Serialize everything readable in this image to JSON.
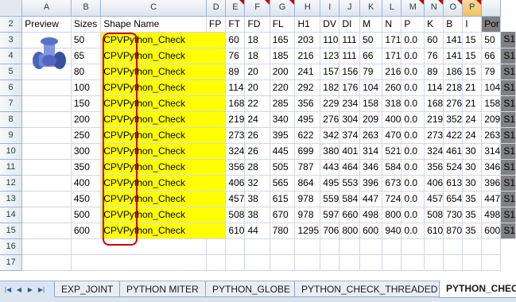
{
  "columns": [
    "A",
    "B",
    "C",
    "D",
    "E",
    "F",
    "G",
    "H",
    "I",
    "J",
    "K",
    "L",
    "M",
    "N",
    "O",
    "P"
  ],
  "header_row": {
    "num": "2",
    "cells": [
      "Preview",
      "Sizes",
      "Shape Name",
      "",
      "FP",
      "FT",
      "FD",
      "FL",
      "H1",
      "DV",
      "DI",
      "M",
      "N",
      "P",
      "K",
      "B",
      "I",
      "Por"
    ]
  },
  "rows": [
    {
      "num": "3",
      "size": "50",
      "shape": "CPVPython_Check",
      "v": [
        "60",
        "18",
        "165",
        "203",
        "110",
        "111",
        "50",
        "171",
        "0.0",
        "60",
        "141",
        "15",
        "50"
      ],
      "last": "S1"
    },
    {
      "num": "4",
      "size": "65",
      "shape": "CPVPython_Check",
      "v": [
        "76",
        "18",
        "185",
        "216",
        "123",
        "111",
        "66",
        "171",
        "0.0",
        "76",
        "141",
        "15",
        "66"
      ],
      "last": "S1"
    },
    {
      "num": "5",
      "size": "80",
      "shape": "CPVPython_Check",
      "v": [
        "89",
        "20",
        "200",
        "241",
        "157",
        "156",
        "79",
        "216",
        "0.0",
        "89",
        "186",
        "15",
        "79"
      ],
      "last": "S1"
    },
    {
      "num": "6",
      "size": "100",
      "shape": "CPVPython_Check",
      "v": [
        "114",
        "20",
        "220",
        "292",
        "182",
        "176",
        "104",
        "260",
        "0.0",
        "114",
        "218",
        "21",
        "104"
      ],
      "last": "S1"
    },
    {
      "num": "7",
      "size": "150",
      "shape": "CPVPython_Check",
      "v": [
        "168",
        "22",
        "285",
        "356",
        "229",
        "234",
        "158",
        "318",
        "0.0",
        "168",
        "276",
        "21",
        "158"
      ],
      "last": "S1"
    },
    {
      "num": "8",
      "size": "200",
      "shape": "CPVPython_Check",
      "v": [
        "219",
        "24",
        "340",
        "495",
        "276",
        "304",
        "209",
        "400",
        "0.0",
        "219",
        "352",
        "24",
        "209"
      ],
      "last": "S1"
    },
    {
      "num": "9",
      "size": "250",
      "shape": "CPVPython_Check",
      "v": [
        "273",
        "26",
        "395",
        "622",
        "342",
        "374",
        "263",
        "470",
        "0.0",
        "273",
        "422",
        "24",
        "263"
      ],
      "last": "S1"
    },
    {
      "num": "10",
      "size": "300",
      "shape": "CPVPython_Check",
      "v": [
        "324",
        "26",
        "445",
        "699",
        "380",
        "401",
        "314",
        "521",
        "0.0",
        "324",
        "461",
        "30",
        "314"
      ],
      "last": "S1"
    },
    {
      "num": "11",
      "size": "350",
      "shape": "CPVPython_Check",
      "v": [
        "356",
        "28",
        "505",
        "787",
        "443",
        "464",
        "346",
        "584",
        "0.0",
        "356",
        "524",
        "30",
        "346"
      ],
      "last": "S1"
    },
    {
      "num": "12",
      "size": "400",
      "shape": "CPVPython_Check",
      "v": [
        "406",
        "32",
        "565",
        "864",
        "495",
        "553",
        "396",
        "673",
        "0.0",
        "406",
        "613",
        "30",
        "396"
      ],
      "last": "S1"
    },
    {
      "num": "13",
      "size": "450",
      "shape": "CPVPython_Check",
      "v": [
        "457",
        "38",
        "615",
        "978",
        "559",
        "584",
        "447",
        "724",
        "0.0",
        "457",
        "654",
        "35",
        "447"
      ],
      "last": "S1"
    },
    {
      "num": "14",
      "size": "500",
      "shape": "CPVPython_Check",
      "v": [
        "508",
        "38",
        "670",
        "978",
        "597",
        "660",
        "498",
        "800",
        "0.0",
        "508",
        "730",
        "35",
        "498"
      ],
      "last": "S1"
    },
    {
      "num": "15",
      "size": "600",
      "shape": "CPVPython_Check",
      "v": [
        "610",
        "44",
        "780",
        "1295",
        "706",
        "800",
        "600",
        "940",
        "0.0",
        "610",
        "870",
        "35",
        "600"
      ],
      "last": "S1"
    },
    {
      "num": "16"
    },
    {
      "num": "17"
    }
  ],
  "tabs": [
    "EXP_JOINT",
    "PYTHON MITER",
    "PYTHON_GLOBE",
    "PYTHON_CHECK_THREADED",
    "PYTHON_CHEC"
  ],
  "preview_icon": "valve-3d-icon",
  "colors": {
    "highlight": "#ffff00",
    "outline": "#cc0000",
    "gray_column": "#808080"
  }
}
